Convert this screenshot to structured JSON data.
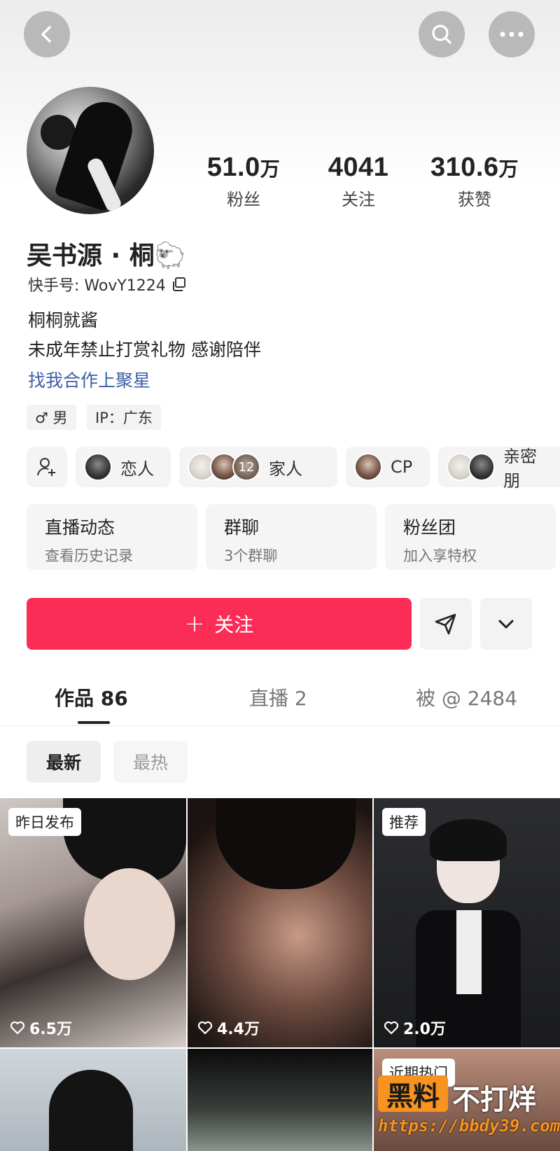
{
  "header": {
    "back_icon": "chevron-left-icon",
    "search_icon": "search-icon",
    "more_icon": "more-dots-icon"
  },
  "profile": {
    "name": "吴书源 · 桐🐑",
    "uid": "快手号: WovY1224",
    "bio_lines": [
      "桐桐就酱",
      "未成年禁止打赏礼物 感谢陪伴"
    ],
    "link_text": "找我合作上聚星",
    "tags": [
      "♂ 男",
      "IP：广东"
    ]
  },
  "stats": [
    {
      "num": "51.0",
      "unit": "万",
      "label": "粉丝"
    },
    {
      "num": "4041",
      "unit": "",
      "label": "关注"
    },
    {
      "num": "310.6",
      "unit": "万",
      "label": "获赞"
    }
  ],
  "relations": [
    {
      "label": "恋人"
    },
    {
      "label": "家人",
      "count": "12"
    },
    {
      "label": "CP"
    },
    {
      "label": "亲密朋"
    }
  ],
  "cards": [
    {
      "title": "直播动态",
      "sub": "查看历史记录"
    },
    {
      "title": "群聊",
      "sub": "3个群聊"
    },
    {
      "title": "粉丝团",
      "sub": "加入享特权"
    }
  ],
  "actions": {
    "follow_label": "关注",
    "follow_plus": "+"
  },
  "tabs": [
    {
      "label": "作品 86"
    },
    {
      "label": "直播 2"
    },
    {
      "label": "被 @ 2484"
    }
  ],
  "sort": [
    "最新",
    "最热"
  ],
  "videos": [
    {
      "badge": "昨日发布",
      "likes": "6.5万"
    },
    {
      "badge": "",
      "likes": "4.4万"
    },
    {
      "badge": "推荐",
      "likes": "2.0万"
    },
    {
      "badge": "",
      "likes": ""
    },
    {
      "badge": "",
      "likes": ""
    },
    {
      "badge": "近期热门",
      "likes": ""
    }
  ],
  "watermark": {
    "box": "黑料",
    "text": "不打烊",
    "url": "https://bbdy39.com"
  },
  "colors": {
    "accent": "#fb2c55",
    "link": "#3c5fa8",
    "watermark": "#f7931e"
  }
}
